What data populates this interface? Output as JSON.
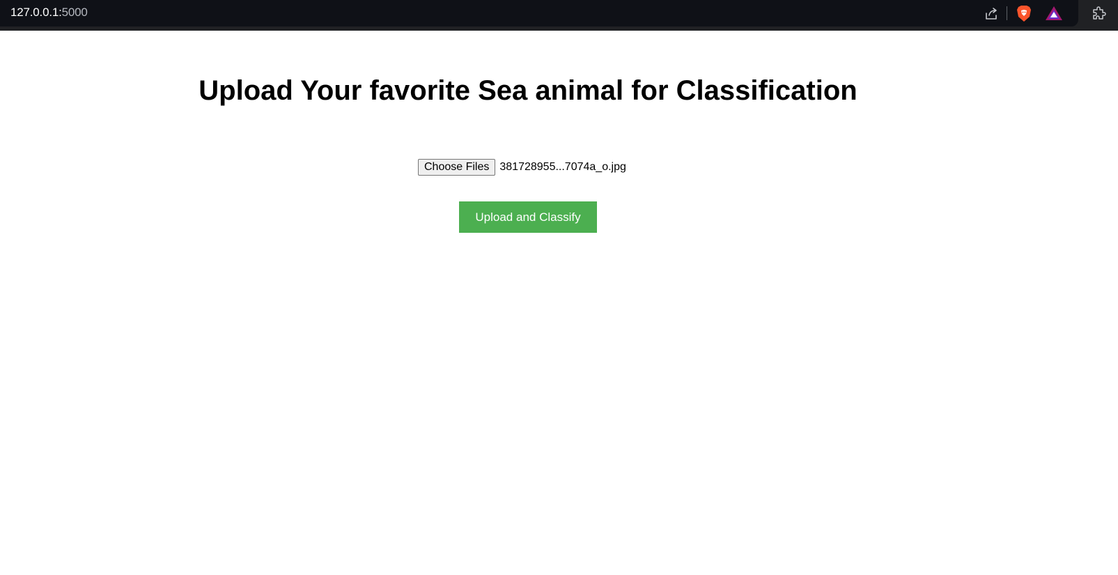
{
  "browser": {
    "url_host": "127.0.0.1:",
    "url_port": "5000",
    "icons": [
      "share-icon",
      "brave-shields-icon",
      "brave-rewards-icon",
      "extensions-icon"
    ]
  },
  "page": {
    "title": "Upload Your favorite Sea animal for Classification",
    "file_input": {
      "button_label": "Choose Files",
      "selected_file": "381728955...7074a_o.jpg"
    },
    "submit_label": "Upload and Classify"
  },
  "colors": {
    "accent": "#4caf50",
    "browser_bar": "#0f1117"
  }
}
